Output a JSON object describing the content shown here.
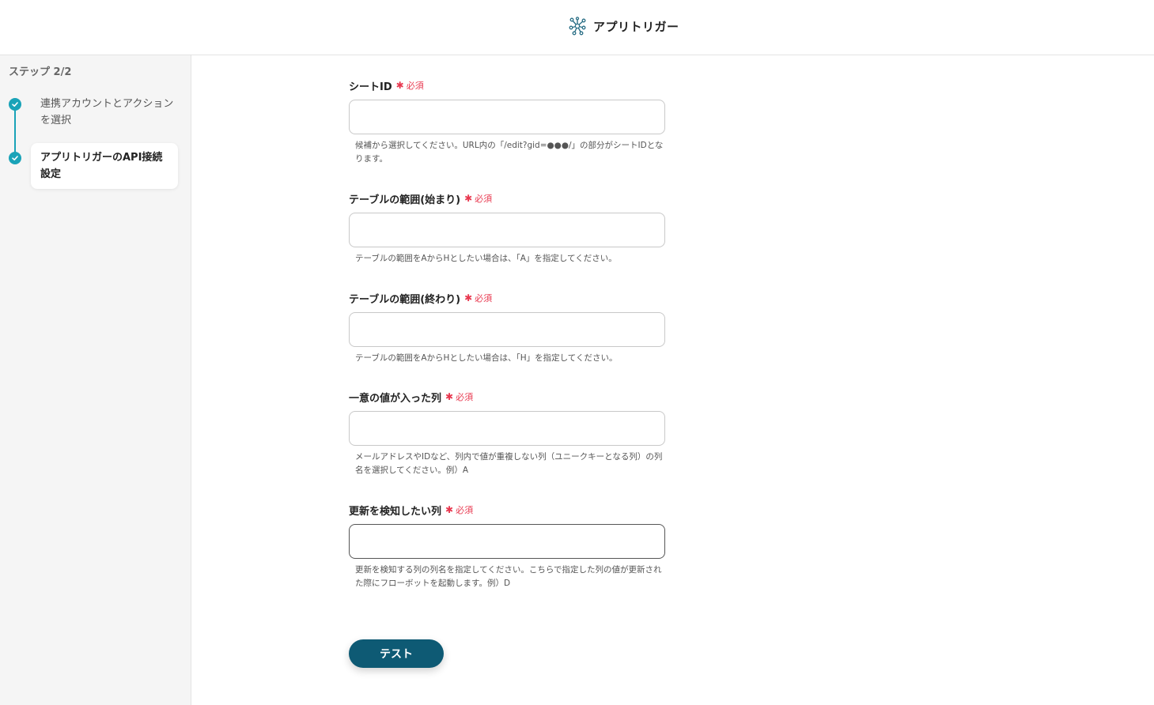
{
  "header": {
    "title": "アプリトリガー",
    "logo_icon": "network-nodes-icon",
    "accent": "#1aa3b8"
  },
  "sidebar": {
    "step_count": "ステップ 2/2",
    "steps": [
      {
        "label": "連携アカウントとアクションを選択",
        "status": "completed"
      },
      {
        "label": "アプリトリガーのAPI接続設定",
        "status": "current"
      }
    ]
  },
  "form": {
    "required_label": "必須",
    "fields": [
      {
        "label": "シートID",
        "value": "",
        "help": "候補から選択してください。URL内の「/edit?gid=●●●/」の部分がシートIDとなります。"
      },
      {
        "label": "テーブルの範囲(始まり)",
        "value": "",
        "help": "テーブルの範囲をAからHとしたい場合は、「A」を指定してください。"
      },
      {
        "label": "テーブルの範囲(終わり)",
        "value": "",
        "help": "テーブルの範囲をAからHとしたい場合は、「H」を指定してください。"
      },
      {
        "label": "一意の値が入った列",
        "value": "",
        "help": "メールアドレスやIDなど、列内で値が重複しない列（ユニークキーとなる列）の列名を選択してください。例）A"
      },
      {
        "label": "更新を検知したい列",
        "value": "",
        "help": "更新を検知する列の列名を指定してください。こちらで指定した列の値が更新された際にフローボットを起動します。例）D"
      }
    ],
    "test_button": "テスト",
    "colors": {
      "required": "#e8384f",
      "button": "#0e5a74"
    }
  }
}
